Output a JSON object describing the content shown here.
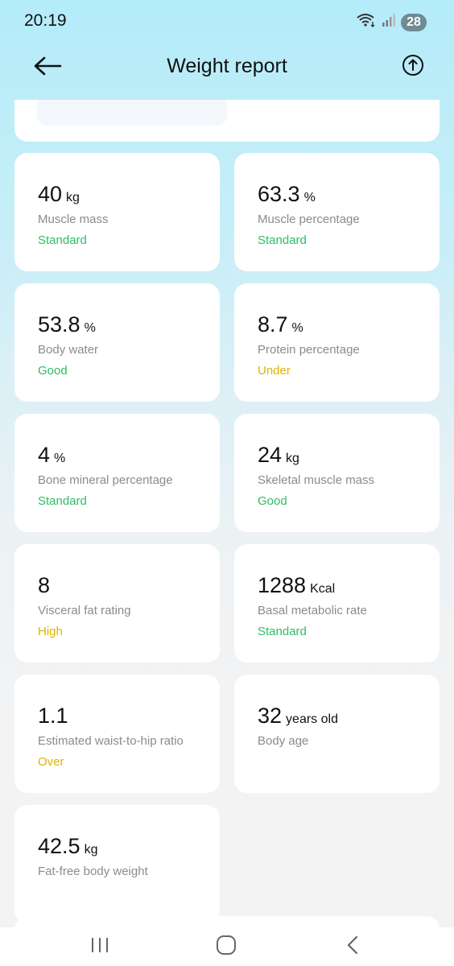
{
  "status_bar": {
    "time": "20:19",
    "battery": "28"
  },
  "header": {
    "title": "Weight report"
  },
  "colors": {
    "good": "#2dbd63",
    "warn": "#e0b400"
  },
  "metrics": [
    {
      "value": "40",
      "unit": "kg",
      "label": "Muscle mass",
      "status": "Standard",
      "status_type": "good"
    },
    {
      "value": "63.3",
      "unit": "%",
      "label": "Muscle percentage",
      "status": "Standard",
      "status_type": "good"
    },
    {
      "value": "53.8",
      "unit": "%",
      "label": "Body water",
      "status": "Good",
      "status_type": "good"
    },
    {
      "value": "8.7",
      "unit": "%",
      "label": "Protein percentage",
      "status": "Under",
      "status_type": "warn"
    },
    {
      "value": "4",
      "unit": "%",
      "label": "Bone mineral percentage",
      "status": "Standard",
      "status_type": "good"
    },
    {
      "value": "24",
      "unit": "kg",
      "label": "Skeletal muscle mass",
      "status": "Good",
      "status_type": "good"
    },
    {
      "value": "8",
      "unit": "",
      "label": "Visceral fat rating",
      "status": "High",
      "status_type": "warn"
    },
    {
      "value": "1288",
      "unit": "Kcal",
      "label": "Basal metabolic rate",
      "status": "Standard",
      "status_type": "good"
    },
    {
      "value": "1.1",
      "unit": "",
      "label": "Estimated waist-to-hip ratio",
      "status": "Over",
      "status_type": "warn"
    },
    {
      "value": "32",
      "unit": "years old",
      "label": "Body age",
      "status": "",
      "status_type": "good"
    },
    {
      "value": "42.5",
      "unit": "kg",
      "label": "Fat-free body weight",
      "status": "",
      "status_type": "good"
    }
  ],
  "nav": {
    "recents_icon": "recents-icon",
    "home_icon": "home-icon",
    "back_icon": "nav-back-icon"
  }
}
